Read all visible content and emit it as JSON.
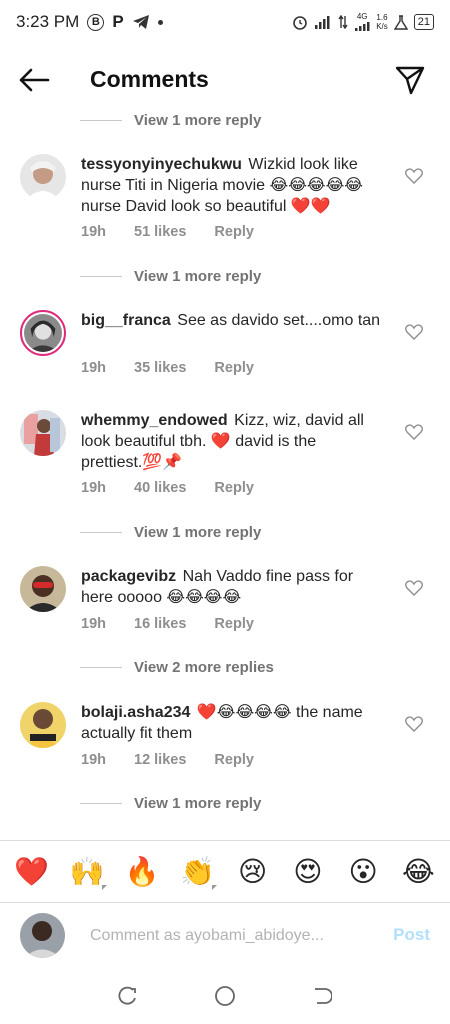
{
  "status_bar": {
    "time": "3:23 PM",
    "network": "4G",
    "speed_value": "1.6",
    "speed_unit": "K/s",
    "battery": "21"
  },
  "header": {
    "title": "Comments"
  },
  "comments": [
    {
      "type": "more_replies",
      "label": "View 1 more reply"
    },
    {
      "type": "comment",
      "username": "tessyonyinyechukwu",
      "text": "Wizkid look like nurse Titi in Nigeria movie 😂😂😂😂😂 nurse David look so beautiful ❤️❤️",
      "time": "19h",
      "likes": "51 likes",
      "reply": "Reply"
    },
    {
      "type": "more_replies",
      "label": "View 1 more reply"
    },
    {
      "type": "comment",
      "username": "big__franca",
      "text": "See as davido set....omo tan",
      "time": "19h",
      "likes": "35 likes",
      "reply": "Reply"
    },
    {
      "type": "comment",
      "username": "whemmy_endowed",
      "text": "Kizz, wiz, david all look beautiful tbh. ❤️  david is the prettiest.💯📌",
      "time": "19h",
      "likes": "40 likes",
      "reply": "Reply"
    },
    {
      "type": "more_replies",
      "label": "View 1 more reply"
    },
    {
      "type": "comment",
      "username": "packagevibz",
      "text": "Nah Vaddo fine pass for here ooooo 😂😂😂😂",
      "time": "19h",
      "likes": "16 likes",
      "reply": "Reply"
    },
    {
      "type": "more_replies",
      "label": "View 2 more replies"
    },
    {
      "type": "comment",
      "username": "bolaji.asha234",
      "text": "❤️😂😂😂😂 the name actually fit them",
      "time": "19h",
      "likes": "12 likes",
      "reply": "Reply"
    },
    {
      "type": "more_replies",
      "label": "View 1 more reply"
    }
  ],
  "emoji_bar": [
    "❤️",
    "🙌",
    "🔥",
    "👏",
    "😢",
    "😍",
    "😮",
    "😂"
  ],
  "composer": {
    "placeholder": "Comment as ayobami_abidoye...",
    "post_label": "Post"
  },
  "colors": {
    "post_disabled": "#b2dffc",
    "story_ring": "#dd2a7b",
    "meta_gray": "#8e8e8e"
  }
}
